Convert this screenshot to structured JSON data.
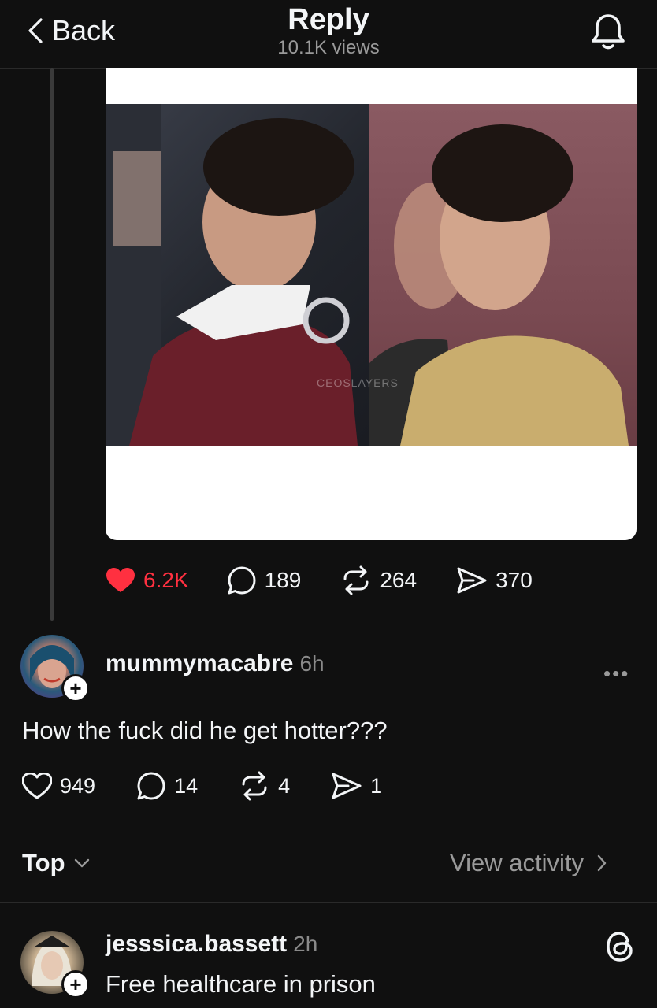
{
  "header": {
    "back_label": "Back",
    "title": "Reply",
    "views": "10.1K views"
  },
  "post": {
    "watermark": "CEOSLAYERS",
    "likes": "6.2K",
    "comments": "189",
    "reposts": "264",
    "shares": "370",
    "like_color": "#ff3040"
  },
  "reply": {
    "username": "mummymacabre",
    "time": "6h",
    "text": "How the fuck did he get hotter???",
    "likes": "949",
    "comments": "14",
    "reposts": "4",
    "shares": "1"
  },
  "sort": {
    "label": "Top",
    "view_activity": "View activity"
  },
  "next_reply": {
    "username": "jesssica.bassett",
    "time": "2h",
    "text": "Free healthcare in prison"
  },
  "icons": {
    "back": "chevron-left-icon",
    "bell": "bell-icon",
    "heart": "heart-icon",
    "comment": "comment-bubble-icon",
    "repost": "repost-icon",
    "share": "send-icon",
    "threads": "threads-logo-icon",
    "more": "more-dots-icon"
  }
}
